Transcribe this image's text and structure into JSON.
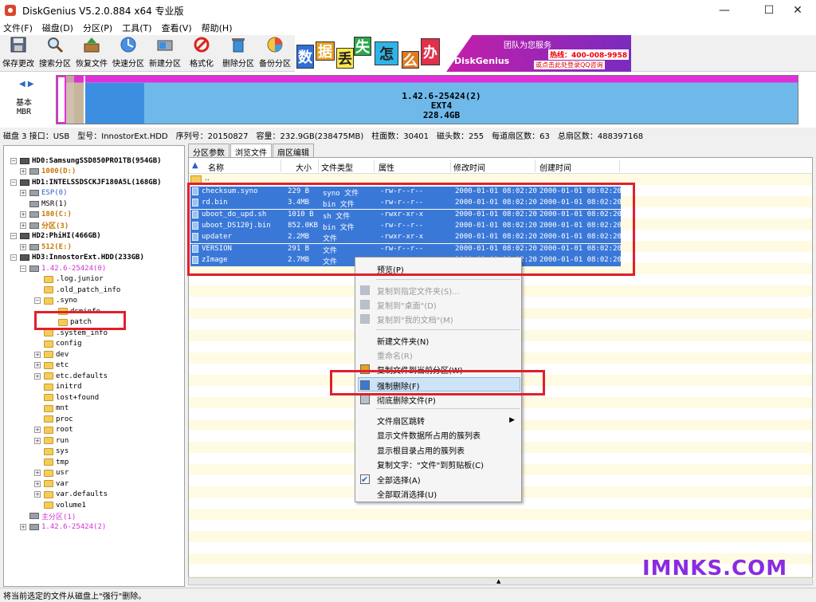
{
  "window": {
    "title": "DiskGenius V5.2.0.884 x64 专业版",
    "minimize": "—",
    "maximize": "☐",
    "close": "✕"
  },
  "menu": [
    "文件(F)",
    "磁盘(D)",
    "分区(P)",
    "工具(T)",
    "查看(V)",
    "帮助(H)"
  ],
  "toolbar": [
    {
      "label": "保存更改",
      "icon": "save-icon"
    },
    {
      "label": "搜索分区",
      "icon": "search-icon"
    },
    {
      "label": "恢复文件",
      "icon": "recover-icon"
    },
    {
      "label": "快速分区",
      "icon": "quick-partition-icon"
    },
    {
      "label": "新建分区",
      "icon": "new-partition-icon"
    },
    {
      "label": "格式化",
      "icon": "format-icon"
    },
    {
      "label": "删除分区",
      "icon": "trash-icon"
    },
    {
      "label": "备份分区",
      "icon": "backup-icon"
    }
  ],
  "ad": {
    "tiles": [
      "数",
      "据",
      "丢",
      "失",
      "怎",
      "么",
      "办"
    ],
    "brand": "DiskGenius",
    "slogan": "团队为您服务",
    "phone": "热线：400-008-9958",
    "qq": "或点击此处登录QQ咨询"
  },
  "diskbar": {
    "label_line1": "基本",
    "label_line2": "MBR",
    "partition_name": "1.42.6-25424(2)",
    "partition_fs": "EXT4",
    "partition_size": "228.4GB"
  },
  "diskinfo": [
    "磁盘 3 接口：USB",
    "型号：InnostorExt.HDD",
    "序列号：20150827",
    "容量：232.9GB(238475MB)",
    "柱面数：30401",
    "磁头数：255",
    "每道扇区数：63",
    "总扇区数：488397168"
  ],
  "tree": [
    {
      "text": "HD0:SamsungSSD850PRO1TB(954GB)",
      "level": 0,
      "type": "disk",
      "style": "bold",
      "exp": "−"
    },
    {
      "text": "1000(D:)",
      "level": 1,
      "type": "part",
      "style": "orange",
      "exp": "+"
    },
    {
      "text": "HD1:INTELSSDSCKJF180A5L(168GB)",
      "level": 0,
      "type": "disk",
      "style": "bold",
      "exp": "−"
    },
    {
      "text": "ESP(0)",
      "level": 1,
      "type": "part",
      "style": "blue",
      "exp": "+"
    },
    {
      "text": "MSR(1)",
      "level": 1,
      "type": "part",
      "style": "",
      "exp": ""
    },
    {
      "text": "180(C:)",
      "level": 1,
      "type": "part",
      "style": "orange",
      "exp": "+"
    },
    {
      "text": "分区(3)",
      "level": 1,
      "type": "part",
      "style": "orange",
      "exp": "+"
    },
    {
      "text": "HD2:PhiHI(466GB)",
      "level": 0,
      "type": "disk",
      "style": "bold",
      "exp": "−"
    },
    {
      "text": "512(E:)",
      "level": 1,
      "type": "part",
      "style": "orange",
      "exp": "+"
    },
    {
      "text": "HD3:InnostorExt.HDD(233GB)",
      "level": 0,
      "type": "disk",
      "style": "bold",
      "exp": "−"
    },
    {
      "text": "1.42.6-25424(0)",
      "level": 1,
      "type": "part",
      "style": "magenta",
      "exp": "−"
    },
    {
      "text": ".log.junior",
      "level": 2,
      "type": "folder",
      "style": "",
      "exp": ""
    },
    {
      "text": ".old_patch_info",
      "level": 2,
      "type": "folder",
      "style": "",
      "exp": ""
    },
    {
      "text": ".syno",
      "level": 2,
      "type": "folder",
      "style": "",
      "exp": "−"
    },
    {
      "text": "dsminfo",
      "level": 3,
      "type": "folder",
      "style": "",
      "exp": ""
    },
    {
      "text": "patch",
      "level": 3,
      "type": "folder",
      "style": "",
      "exp": ""
    },
    {
      "text": ".system_info",
      "level": 2,
      "type": "folder",
      "style": "",
      "exp": ""
    },
    {
      "text": "config",
      "level": 2,
      "type": "folder",
      "style": "",
      "exp": ""
    },
    {
      "text": "dev",
      "level": 2,
      "type": "folder",
      "style": "",
      "exp": "+"
    },
    {
      "text": "etc",
      "level": 2,
      "type": "folder",
      "style": "",
      "exp": "+"
    },
    {
      "text": "etc.defaults",
      "level": 2,
      "type": "folder",
      "style": "",
      "exp": "+"
    },
    {
      "text": "initrd",
      "level": 2,
      "type": "folder",
      "style": "",
      "exp": ""
    },
    {
      "text": "lost+found",
      "level": 2,
      "type": "folder",
      "style": "",
      "exp": ""
    },
    {
      "text": "mnt",
      "level": 2,
      "type": "folder",
      "style": "",
      "exp": ""
    },
    {
      "text": "proc",
      "level": 2,
      "type": "folder",
      "style": "",
      "exp": ""
    },
    {
      "text": "root",
      "level": 2,
      "type": "folder",
      "style": "",
      "exp": "+"
    },
    {
      "text": "run",
      "level": 2,
      "type": "folder",
      "style": "",
      "exp": "+"
    },
    {
      "text": "sys",
      "level": 2,
      "type": "folder",
      "style": "",
      "exp": ""
    },
    {
      "text": "tmp",
      "level": 2,
      "type": "folder",
      "style": "",
      "exp": ""
    },
    {
      "text": "usr",
      "level": 2,
      "type": "folder",
      "style": "",
      "exp": "+"
    },
    {
      "text": "var",
      "level": 2,
      "type": "folder",
      "style": "",
      "exp": "+"
    },
    {
      "text": "var.defaults",
      "level": 2,
      "type": "folder",
      "style": "",
      "exp": "+"
    },
    {
      "text": "volume1",
      "level": 2,
      "type": "folder",
      "style": "",
      "exp": ""
    },
    {
      "text": "主分区(1)",
      "level": 1,
      "type": "part",
      "style": "magenta",
      "exp": ""
    },
    {
      "text": "1.42.6-25424(2)",
      "level": 1,
      "type": "part",
      "style": "magenta",
      "exp": "+"
    }
  ],
  "tabs": [
    "分区参数",
    "浏览文件",
    "扇区编辑"
  ],
  "columns": [
    "名称",
    "大小",
    "文件类型",
    "属性",
    "修改时间",
    "创建时间"
  ],
  "updir": "..",
  "files": [
    {
      "name": "checksum.syno",
      "size": "229 B",
      "type": "syno 文件",
      "attr": "-rw-r--r--",
      "mtime": "2000-01-01 08:02:20",
      "ctime": "2000-01-01 08:02:20"
    },
    {
      "name": "rd.bin",
      "size": "3.4MB",
      "type": "bin 文件",
      "attr": "-rw-r--r--",
      "mtime": "2000-01-01 08:02:20",
      "ctime": "2000-01-01 08:02:20"
    },
    {
      "name": "uboot_do_upd.sh",
      "size": "1010 B",
      "type": "sh 文件",
      "attr": "-rwxr-xr-x",
      "mtime": "2000-01-01 08:02:20",
      "ctime": "2000-01-01 08:02:20"
    },
    {
      "name": "uboot_DS120j.bin",
      "size": "852.0KB",
      "type": "bin 文件",
      "attr": "-rw-r--r--",
      "mtime": "2000-01-01 08:02:20",
      "ctime": "2000-01-01 08:02:20"
    },
    {
      "name": "updater",
      "size": "2.2MB",
      "type": "文件",
      "attr": "-rwxr-xr-x",
      "mtime": "2000-01-01 08:02:20",
      "ctime": "2000-01-01 08:02:20"
    },
    {
      "name": "VERSION",
      "size": "291 B",
      "type": "文件",
      "attr": "-rw-r--r--",
      "mtime": "2000-01-01 08:02:20",
      "ctime": "2000-01-01 08:02:20"
    },
    {
      "name": "zImage",
      "size": "2.7MB",
      "type": "文件",
      "attr": "-rw-r--r--",
      "mtime": "2000-01-01 08:02:20",
      "ctime": "2000-01-01 08:02:20"
    }
  ],
  "context_menu": [
    {
      "label": "预览(P)",
      "enabled": true,
      "icon": ""
    },
    {
      "label": "复制到指定文件夹(S)...",
      "enabled": false,
      "icon": "copy-icon"
    },
    {
      "label": "复制到\"桌面\"(D)",
      "enabled": false,
      "icon": "desktop-icon"
    },
    {
      "label": "复制到\"我的文档\"(M)",
      "enabled": false,
      "icon": "documents-icon"
    },
    {
      "label": "新建文件夹(N)",
      "enabled": true,
      "icon": ""
    },
    {
      "label": "重命名(R)",
      "enabled": false,
      "icon": ""
    },
    {
      "label": "复制文件到当前分区(W)",
      "enabled": true,
      "icon": "copy-partition-icon"
    },
    {
      "label": "强制删除(F)",
      "enabled": true,
      "icon": "force-delete-icon"
    },
    {
      "label": "彻底删除文件(P)",
      "enabled": true,
      "icon": "wipe-icon"
    },
    {
      "label": "文件扇区跳转",
      "enabled": true,
      "icon": ""
    },
    {
      "label": "显示文件数据所占用的簇列表",
      "enabled": true,
      "icon": ""
    },
    {
      "label": "显示根目录占用的簇列表",
      "enabled": true,
      "icon": ""
    },
    {
      "label": "复制文字：\"文件\"到剪贴板(C)",
      "enabled": true,
      "icon": ""
    },
    {
      "label": "全部选择(A)",
      "enabled": true,
      "icon": "check-icon"
    },
    {
      "label": "全部取消选择(U)",
      "enabled": true,
      "icon": ""
    }
  ],
  "status": "将当前选定的文件从磁盘上\"强行\"删除。",
  "watermark": "IMNKS.COM",
  "colors": {
    "selection": "#3a78d8",
    "redbox": "#e0202a",
    "partition_bar": "#e12fd8",
    "partition_fill": "#6fb9ea"
  }
}
